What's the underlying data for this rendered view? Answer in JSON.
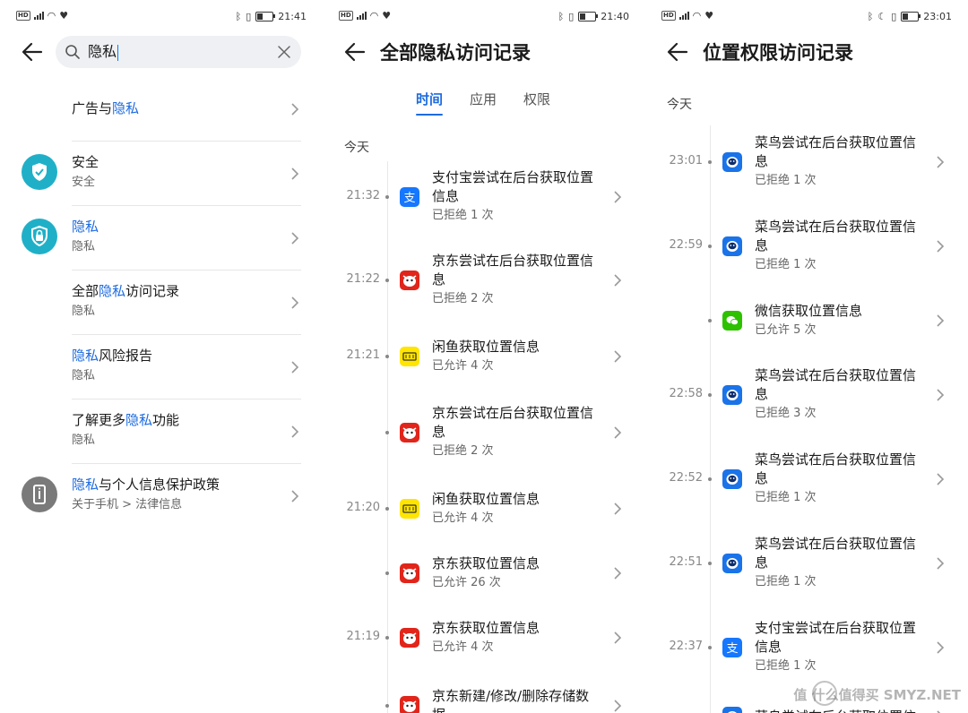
{
  "panel1": {
    "status": {
      "time": "21:41"
    },
    "search": {
      "query": "隐私"
    },
    "items": [
      {
        "pre": "广告与",
        "hl": "隐私",
        "post": "",
        "sub": ""
      },
      {
        "pre": "安全",
        "hl": "",
        "post": "",
        "sub": "安全"
      },
      {
        "pre": "",
        "hl": "隐私",
        "post": "",
        "sub": "隐私"
      },
      {
        "pre": "全部",
        "hl": "隐私",
        "post": "访问记录",
        "sub": "隐私"
      },
      {
        "pre": "",
        "hl": "隐私",
        "post": "风险报告",
        "sub": "隐私"
      },
      {
        "pre": "了解更多",
        "hl": "隐私",
        "post": "功能",
        "sub": "隐私"
      },
      {
        "pre": "",
        "hl": "隐私",
        "post": "与个人信息保护政策",
        "sub": "关于手机 > 法律信息"
      }
    ]
  },
  "panel2": {
    "status": {
      "time": "21:40"
    },
    "title": "全部隐私访问记录",
    "tabs": [
      "时间",
      "应用",
      "权限"
    ],
    "section": "今天",
    "records": [
      {
        "time": "21:32",
        "app": "alipay",
        "title1": "支付宝尝试在后台获取位置",
        "title2": "信息",
        "sub": "已拒绝 1 次"
      },
      {
        "time": "21:22",
        "app": "jd",
        "title1": "京东尝试在后台获取位置信",
        "title2": "息",
        "sub": "已拒绝 2 次"
      },
      {
        "time": "21:21",
        "app": "xianyu",
        "title1": "闲鱼获取位置信息",
        "title2": "",
        "sub": "已允许 4 次"
      },
      {
        "time": "",
        "app": "jd",
        "title1": "京东尝试在后台获取位置信",
        "title2": "息",
        "sub": "已拒绝 2 次"
      },
      {
        "time": "21:20",
        "app": "xianyu",
        "title1": "闲鱼获取位置信息",
        "title2": "",
        "sub": "已允许 4 次"
      },
      {
        "time": "",
        "app": "jd",
        "title1": "京东获取位置信息",
        "title2": "",
        "sub": "已允许 26 次"
      },
      {
        "time": "21:19",
        "app": "jd",
        "title1": "京东获取位置信息",
        "title2": "",
        "sub": "已允许 4 次"
      },
      {
        "time": "",
        "app": "jd",
        "title1": "京东新建/修改/删除存储数",
        "title2": "据",
        "sub": ""
      }
    ]
  },
  "panel3": {
    "status": {
      "time": "23:01"
    },
    "title": "位置权限访问记录",
    "section": "今天",
    "records": [
      {
        "time": "23:01",
        "app": "cainiao",
        "title1": "菜鸟尝试在后台获取位置信",
        "title2": "息",
        "sub": "已拒绝 1 次"
      },
      {
        "time": "22:59",
        "app": "cainiao",
        "title1": "菜鸟尝试在后台获取位置信",
        "title2": "息",
        "sub": "已拒绝 1 次"
      },
      {
        "time": "",
        "app": "wechat",
        "title1": "微信获取位置信息",
        "title2": "",
        "sub": "已允许 5 次"
      },
      {
        "time": "22:58",
        "app": "cainiao",
        "title1": "菜鸟尝试在后台获取位置信",
        "title2": "息",
        "sub": "已拒绝 3 次"
      },
      {
        "time": "22:52",
        "app": "cainiao",
        "title1": "菜鸟尝试在后台获取位置信",
        "title2": "息",
        "sub": "已拒绝 1 次"
      },
      {
        "time": "22:51",
        "app": "cainiao",
        "title1": "菜鸟尝试在后台获取位置信",
        "title2": "息",
        "sub": "已拒绝 1 次"
      },
      {
        "time": "22:37",
        "app": "alipay",
        "title1": "支付宝尝试在后台获取位置",
        "title2": "信息",
        "sub": "已拒绝 1 次"
      },
      {
        "time": "",
        "app": "cainiao",
        "title1": "菜鸟尝试在后台获取位置信",
        "title2": "",
        "sub": ""
      }
    ]
  },
  "watermark": "值 什么值得买 SMYZ.NET",
  "colors": {
    "accent": "#1d6be0",
    "security_icon": "#1fb0c8",
    "policy_icon": "#7a7a7a",
    "alipay": "#1677ff",
    "jd": "#e1251b",
    "xianyu": "#ffe500",
    "cainiao": "#1a73e8",
    "wechat": "#2dc100"
  }
}
